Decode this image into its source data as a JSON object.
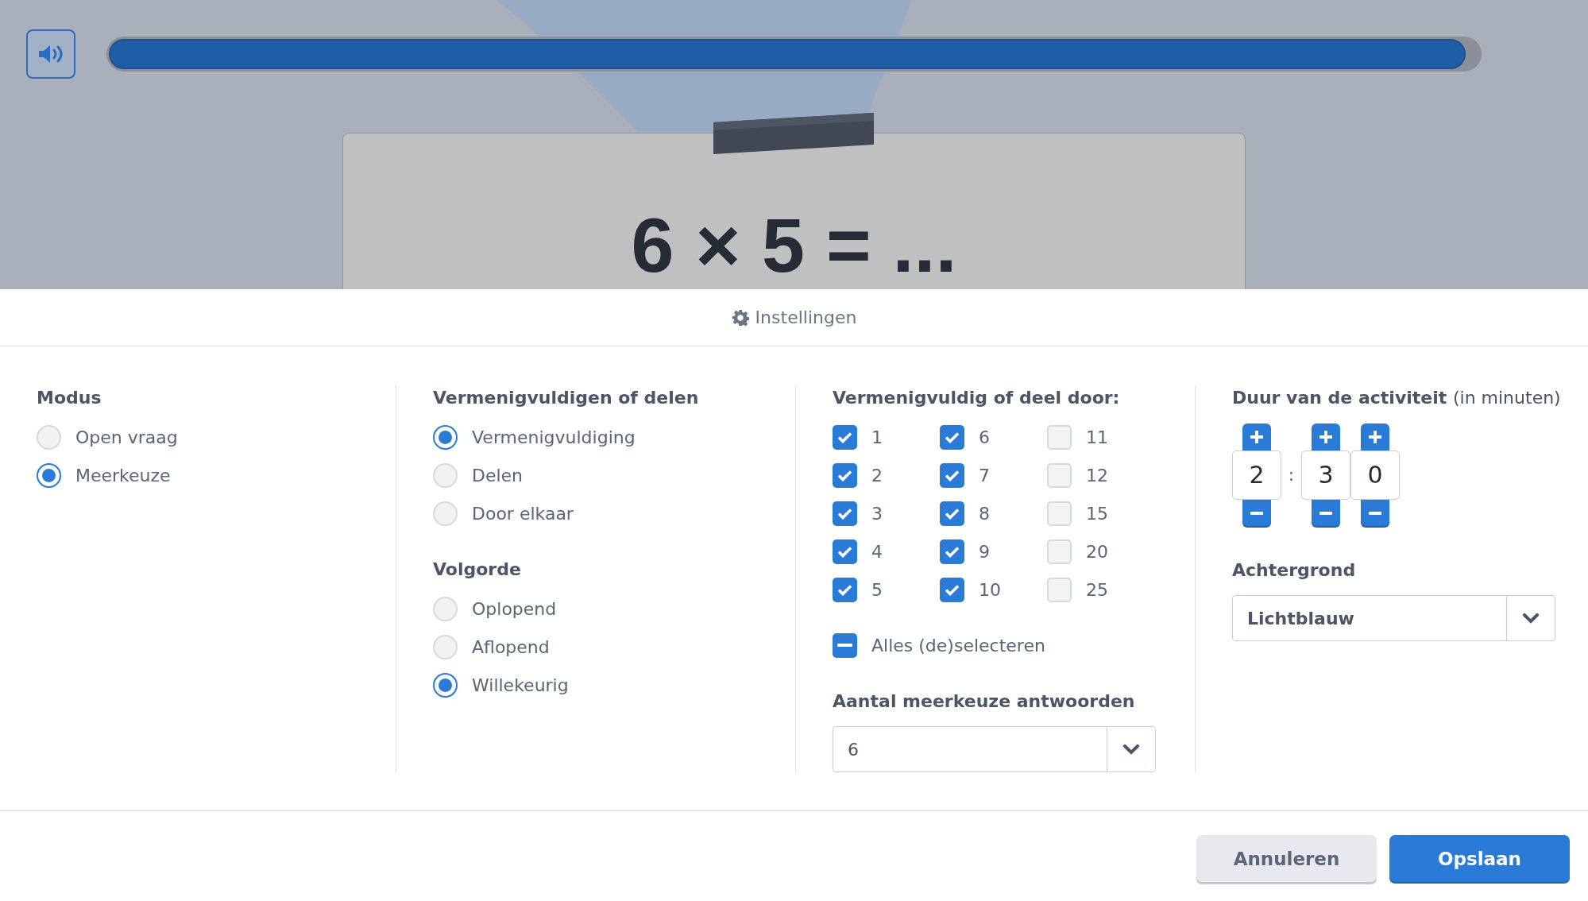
{
  "progress": {
    "level": 0.99
  },
  "question": {
    "text": "6 × 5 = ..."
  },
  "settings_title": "Instellingen",
  "modus": {
    "title": "Modus",
    "options": [
      {
        "label": "Open vraag",
        "selected": false
      },
      {
        "label": "Meerkeuze",
        "selected": true
      }
    ]
  },
  "operation": {
    "title": "Vermenigvuldigen of delen",
    "options": [
      {
        "label": "Vermenigvuldiging",
        "selected": true
      },
      {
        "label": "Delen",
        "selected": false
      },
      {
        "label": "Door elkaar",
        "selected": false
      }
    ]
  },
  "order": {
    "title": "Volgorde",
    "options": [
      {
        "label": "Oplopend",
        "selected": false
      },
      {
        "label": "Aflopend",
        "selected": false
      },
      {
        "label": "Willekeurig",
        "selected": true
      }
    ]
  },
  "divisors": {
    "title": "Vermenigvuldig of deel door:",
    "items": [
      {
        "label": "1",
        "checked": true
      },
      {
        "label": "6",
        "checked": true
      },
      {
        "label": "11",
        "checked": false
      },
      {
        "label": "2",
        "checked": true
      },
      {
        "label": "7",
        "checked": true
      },
      {
        "label": "12",
        "checked": false
      },
      {
        "label": "3",
        "checked": true
      },
      {
        "label": "8",
        "checked": true
      },
      {
        "label": "15",
        "checked": false
      },
      {
        "label": "4",
        "checked": true
      },
      {
        "label": "9",
        "checked": true
      },
      {
        "label": "20",
        "checked": false
      },
      {
        "label": "5",
        "checked": true
      },
      {
        "label": "10",
        "checked": true
      },
      {
        "label": "25",
        "checked": false
      }
    ],
    "select_all": {
      "label": "Alles (de)selecteren",
      "indeterminate": true
    }
  },
  "answers_count": {
    "title": "Aantal meerkeuze antwoorden",
    "value": "6"
  },
  "duration": {
    "title": "Duur van de activiteit",
    "unit": "(in minuten)",
    "separator": ":",
    "groups": [
      {
        "digits": [
          "2"
        ]
      },
      {
        "digits": [
          "3",
          "0"
        ]
      }
    ]
  },
  "background": {
    "title": "Achtergrond",
    "value": "Lichtblauw"
  },
  "buttons": [
    {
      "label": "Annuleren",
      "kind": "secondary"
    },
    {
      "label": "Opslaan",
      "kind": "primary"
    }
  ]
}
